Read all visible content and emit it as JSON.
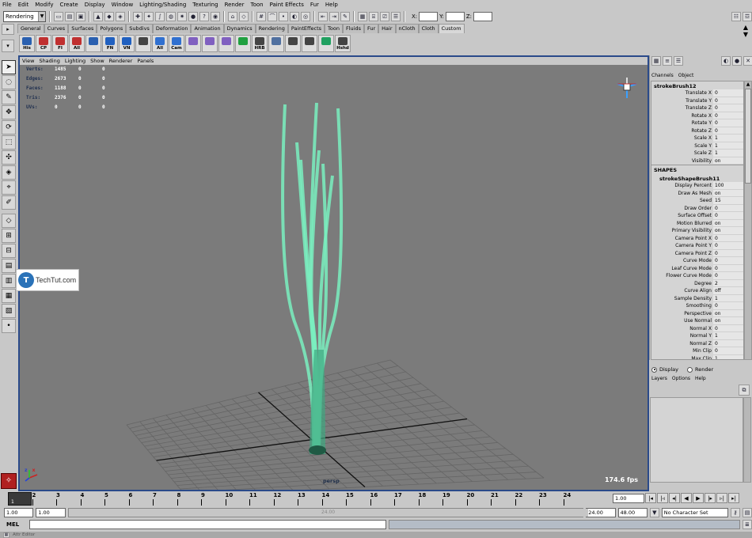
{
  "menus": [
    "File",
    "Edit",
    "Modify",
    "Create",
    "Display",
    "Window",
    "Lighting/Shading",
    "Texturing",
    "Render",
    "Toon",
    "Paint Effects",
    "Fur",
    "Help"
  ],
  "status_line": {
    "mode": "Rendering",
    "x_label": "X:",
    "y_label": "Y:",
    "z_label": "Z:"
  },
  "shelf_tabs": [
    "General",
    "Curves",
    "Surfaces",
    "Polygons",
    "Subdivs",
    "Deformation",
    "Animation",
    "Dynamics",
    "Rendering",
    "PaintEffects",
    "Toon",
    "Fluids",
    "Fur",
    "Hair",
    "nCloth",
    "Cloth",
    "Custom"
  ],
  "shelf_tab_active": "Custom",
  "shelf_buttons": [
    "His",
    "CP",
    "FI",
    "All",
    "",
    "FN",
    "VN",
    "",
    "All",
    "Cam",
    "",
    "",
    "",
    "",
    "HRB",
    "",
    "",
    "",
    "",
    "Hshd"
  ],
  "viewport": {
    "menus": [
      "View",
      "Shading",
      "Lighting",
      "Show",
      "Renderer",
      "Panels"
    ],
    "hud": [
      {
        "label": "Verts:",
        "values": [
          "1485",
          "0",
          "0"
        ]
      },
      {
        "label": "Edges:",
        "values": [
          "2673",
          "0",
          "0"
        ]
      },
      {
        "label": "Faces:",
        "values": [
          "1188",
          "0",
          "0"
        ]
      },
      {
        "label": "Tris:",
        "values": [
          "2376",
          "0",
          "0"
        ]
      },
      {
        "label": "UVs:",
        "values": [
          "0",
          "0",
          "0"
        ]
      }
    ],
    "camera": "persp",
    "fps": "174.6 fps",
    "axis_x": "x",
    "axis_z": "z",
    "stroke_color": "#7af0c0",
    "background": "#7b7b7b"
  },
  "watermark": {
    "glyph": "T",
    "text": "TechTut.com"
  },
  "channel_box": {
    "tabs": [
      "Channels",
      "Object"
    ],
    "node": "strokeBrush12",
    "transform_attrs": [
      {
        "name": "Translate X",
        "value": "0"
      },
      {
        "name": "Translate Y",
        "value": "0"
      },
      {
        "name": "Translate Z",
        "value": "0"
      },
      {
        "name": "Rotate X",
        "value": "0"
      },
      {
        "name": "Rotate Y",
        "value": "0"
      },
      {
        "name": "Rotate Z",
        "value": "0"
      },
      {
        "name": "Scale X",
        "value": "1"
      },
      {
        "name": "Scale Y",
        "value": "1"
      },
      {
        "name": "Scale Z",
        "value": "1"
      },
      {
        "name": "Visibility",
        "value": "on"
      }
    ],
    "shapes_header": "SHAPES",
    "shape_node": "strokeShapeBrush11",
    "shape_attrs": [
      {
        "name": "Display Percent",
        "value": "100"
      },
      {
        "name": "Draw As Mesh",
        "value": "on"
      },
      {
        "name": "Seed",
        "value": "15"
      },
      {
        "name": "Draw Order",
        "value": "0"
      },
      {
        "name": "Surface Offset",
        "value": "0"
      },
      {
        "name": "Motion Blurred",
        "value": "on"
      },
      {
        "name": "Primary Visibility",
        "value": "on"
      },
      {
        "name": "Camera Point X",
        "value": "0"
      },
      {
        "name": "Camera Point Y",
        "value": "0"
      },
      {
        "name": "Camera Point Z",
        "value": "0"
      },
      {
        "name": "Curve Mode",
        "value": "0"
      },
      {
        "name": "Leaf Curve Mode",
        "value": "0"
      },
      {
        "name": "Flower Curve Mode",
        "value": "0"
      },
      {
        "name": "Degree",
        "value": "2"
      },
      {
        "name": "Curve Align",
        "value": "off"
      },
      {
        "name": "Sample Density",
        "value": "1"
      },
      {
        "name": "Smoothing",
        "value": "0"
      },
      {
        "name": "Perspective",
        "value": "on"
      },
      {
        "name": "Use Normal",
        "value": "on"
      },
      {
        "name": "Normal X",
        "value": "0"
      },
      {
        "name": "Normal Y",
        "value": "1"
      },
      {
        "name": "Normal Z",
        "value": "0"
      },
      {
        "name": "Min Clip",
        "value": "0"
      },
      {
        "name": "Max Clip",
        "value": "1"
      }
    ]
  },
  "layer_editor": {
    "display_label": "Display",
    "render_label": "Render",
    "selected": "Display",
    "menus": [
      "Layers",
      "Options",
      "Help"
    ]
  },
  "timeline": {
    "current": "1",
    "ticks": [
      "1",
      "2",
      "3",
      "4",
      "5",
      "6",
      "7",
      "8",
      "9",
      "10",
      "11",
      "12",
      "13",
      "14",
      "15",
      "16",
      "17",
      "18",
      "19",
      "20",
      "21",
      "22",
      "23",
      "24"
    ],
    "current_field": "1.00"
  },
  "range": {
    "start": "1.00",
    "playback_start": "1.00",
    "slider_text": "24.00",
    "playback_end": "24.00",
    "end": "48.00",
    "character_set": "No Character Set"
  },
  "command_line": {
    "label": "MEL"
  },
  "taskbar": {
    "item": "Attr Editor"
  }
}
